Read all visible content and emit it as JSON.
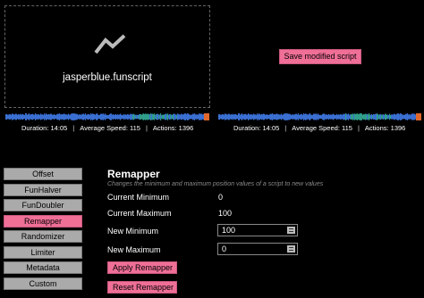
{
  "left_panel": {
    "filename": "jasperblue.funscript",
    "stats": {
      "duration": "Duration: 14:05",
      "speed": "Average Speed: 115",
      "actions": "Actions: 1396",
      "separator": "|"
    }
  },
  "right_panel": {
    "save_button_label": "Save modified script",
    "stats": {
      "duration": "Duration: 14:05",
      "speed": "Average Speed: 115",
      "actions": "Actions: 1396",
      "separator": "|"
    }
  },
  "sidebar": {
    "items": [
      {
        "label": "Offset",
        "active": false
      },
      {
        "label": "FunHalver",
        "active": false
      },
      {
        "label": "FunDoubler",
        "active": false
      },
      {
        "label": "Remapper",
        "active": true
      },
      {
        "label": "Randomizer",
        "active": false
      },
      {
        "label": "Limiter",
        "active": false
      },
      {
        "label": "Metadata",
        "active": false
      },
      {
        "label": "Custom",
        "active": false
      }
    ]
  },
  "remapper": {
    "title": "Remapper",
    "description": "Changes the minimum and maximum position values of a script to new values",
    "current_minimum_label": "Current Minimum",
    "current_minimum_value": "0",
    "current_maximum_label": "Current Maximum",
    "current_maximum_value": "100",
    "new_minimum_label": "New Minimum",
    "new_minimum_value": "100",
    "new_maximum_label": "New Maximum",
    "new_maximum_value": "0",
    "apply_label": "Apply Remapper",
    "reset_label": "Reset Remapper"
  },
  "colors": {
    "accent": "#ef6f97",
    "heatmap_blue": "#3a6fd1",
    "heatmap_green": "#2f9e8a",
    "heatmap_orange": "#e0662b",
    "background": "#000000"
  },
  "icons": {
    "file_icon": "trend-line-icon"
  }
}
